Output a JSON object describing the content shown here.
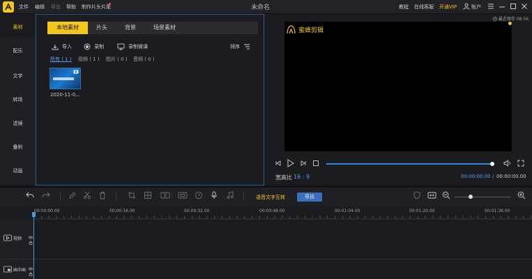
{
  "app": {
    "menu": [
      "文件",
      "编辑",
      "导出",
      "帮助",
      "制作片头片尾"
    ],
    "title": "未命名",
    "right_menu": {
      "tutorial": "教程",
      "support": "在线客服",
      "vip": "开通VIP",
      "account": "账户"
    }
  },
  "left_tabs": [
    "素材",
    "配乐",
    "文字",
    "转场",
    "滤镜",
    "叠附",
    "动画"
  ],
  "media_tabs": [
    "本地素材",
    "片头",
    "背景",
    "场景素材"
  ],
  "actions": {
    "import": "导入",
    "record": "录制",
    "record_lesson": "录制微课",
    "sort": "排序"
  },
  "filters": [
    "所有 ( 1 )",
    "视频 ( 1 )",
    "图片 ( 0 )",
    "音频 ( 0 )"
  ],
  "media_item": {
    "caption": "2020-11-0..."
  },
  "preview": {
    "autosave": "最近保存 08:56",
    "watermark": "蜜蜂剪辑",
    "ratio_label": "宽高比",
    "ratio_value": "16 : 9",
    "time_current": "00:00:00.00",
    "time_separator": "/",
    "time_total": "00:00:00.00",
    "progress": 1.0
  },
  "toolbar": {
    "voice_text": "语音文字互转",
    "export": "导出"
  },
  "timeline": {
    "ticks": [
      "00:00:00.00",
      "00:00:16.00",
      "00:00:32.00",
      "00:00:48.00",
      "00:01:04.00",
      "00:01:20.00",
      "00:01:36.00"
    ],
    "tracks": [
      "视频",
      "画中画"
    ]
  },
  "colors": {
    "accent": "#f4c51c",
    "blue": "#5aa0e8",
    "bg": "#1b1c1f"
  }
}
